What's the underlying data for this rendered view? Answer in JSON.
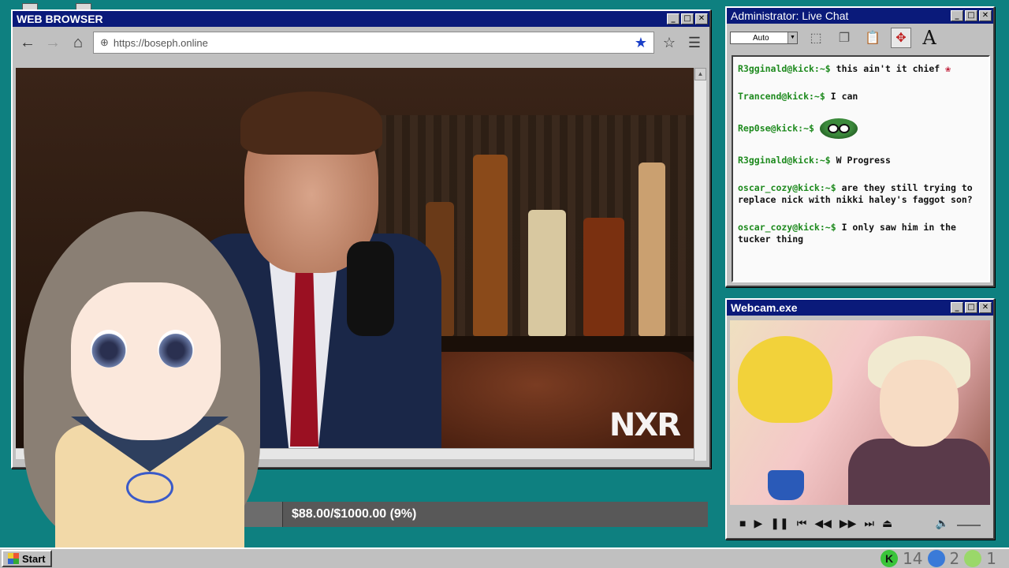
{
  "browser": {
    "title": "WEB BROWSER",
    "url": "https://boseph.online",
    "back_icon": "←",
    "forward_icon": "→",
    "home_icon": "⌂",
    "video_watermark": "NXR"
  },
  "donation": {
    "text": "$88.00/$1000.00 (9%)",
    "progress": 0.09
  },
  "chat": {
    "title": "Administrator: Live Chat",
    "font_combo": "Auto",
    "messages": [
      {
        "user": "R3gginald@kick:~$",
        "text": "this ain't it chief",
        "emote": "rose"
      },
      {
        "user": "Trancend@kick:~$",
        "text": "I can",
        "emote": ""
      },
      {
        "user": "Rep0se@kick:~$",
        "text": "",
        "emote": "pepe"
      },
      {
        "user": "R3gginald@kick:~$",
        "text": "W Progress",
        "emote": ""
      },
      {
        "user": "oscar_cozy@kick:~$",
        "text": "are they still trying to replace nick with nikki haley's faggot son?",
        "emote": ""
      },
      {
        "user": "oscar_cozy@kick:~$",
        "text": "I only saw him in the tucker thing",
        "emote": ""
      }
    ]
  },
  "webcam": {
    "title": "Webcam.exe"
  },
  "taskbar": {
    "start_label": "Start",
    "tray_count_1": "14",
    "tray_count_2": "2",
    "tray_count_3": "1"
  }
}
